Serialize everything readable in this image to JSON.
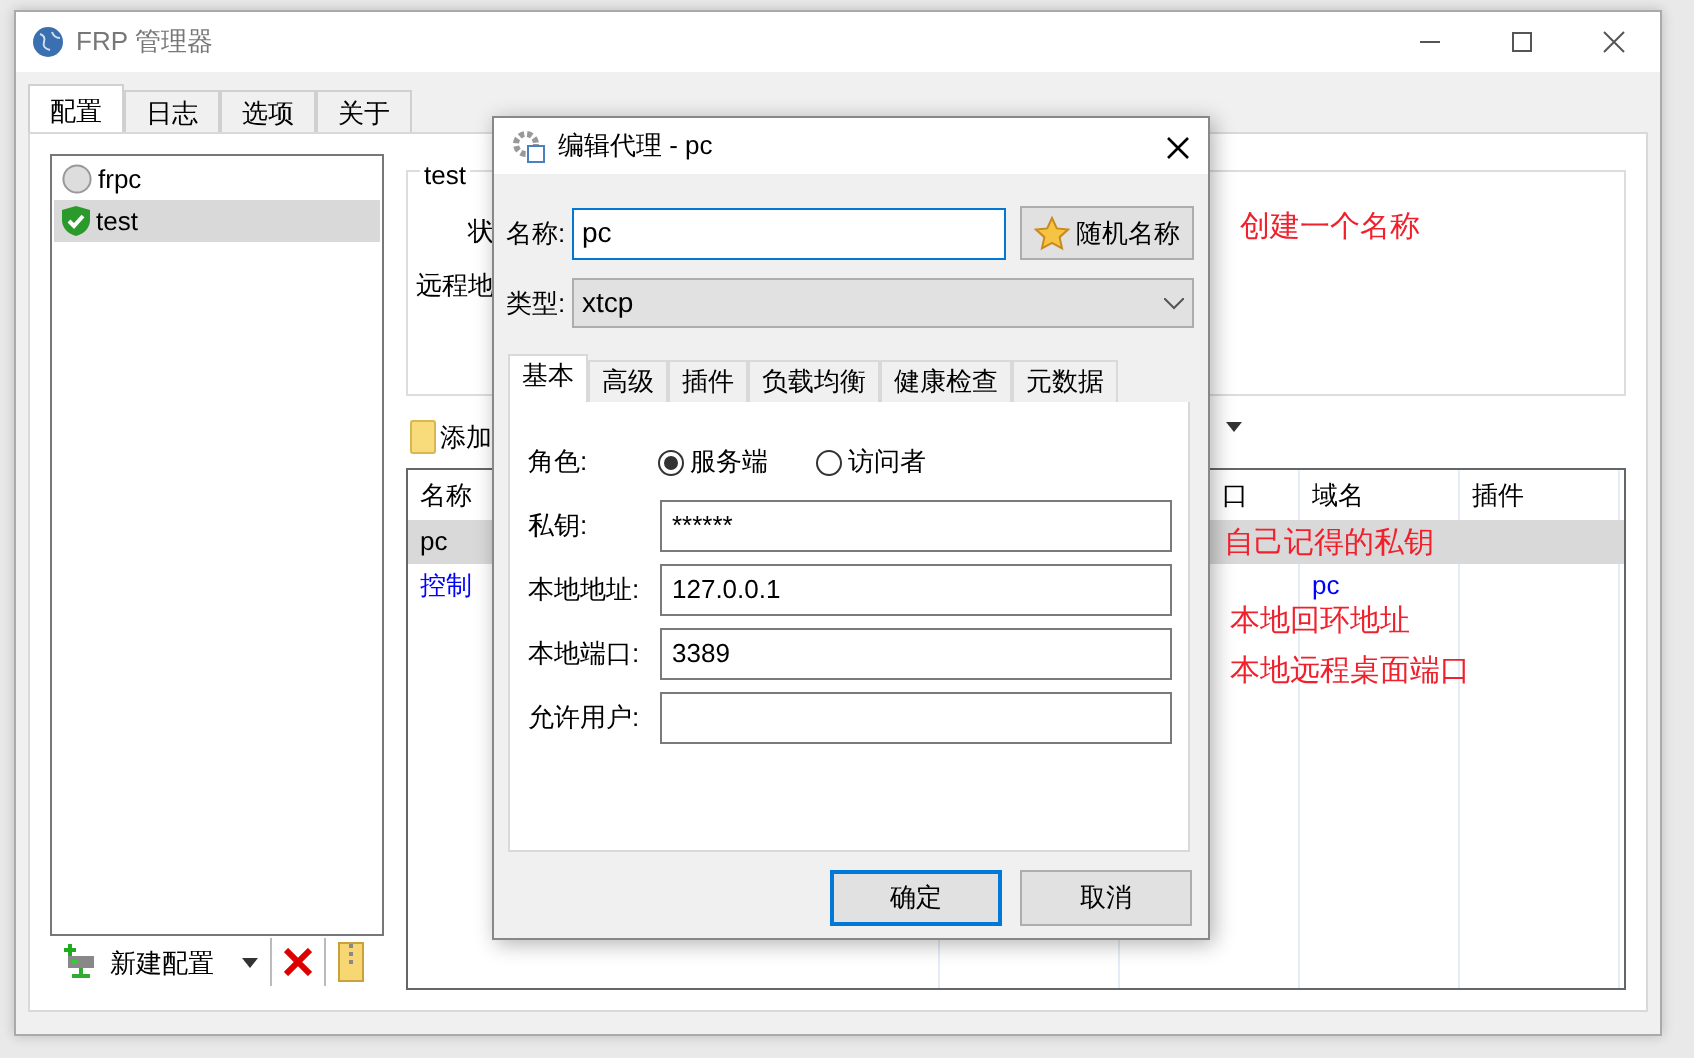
{
  "window": {
    "title": "FRP 管理器"
  },
  "tabs": [
    {
      "label": "配置",
      "selected": true
    },
    {
      "label": "日志",
      "selected": false
    },
    {
      "label": "选项",
      "selected": false
    },
    {
      "label": "关于",
      "selected": false
    }
  ],
  "config_list": [
    {
      "name": "frpc",
      "running": false,
      "selected": false
    },
    {
      "name": "test",
      "running": true,
      "selected": true
    }
  ],
  "list_toolbar": {
    "new_button": "新建配置"
  },
  "detail": {
    "group_title": "test",
    "labels": [
      "状",
      "远程地"
    ]
  },
  "proxy_toolbar": {
    "add_button": "添加"
  },
  "proxy_table": {
    "columns": [
      "名称",
      "口",
      "域名",
      "插件"
    ],
    "rows": [
      {
        "kind": "item",
        "name": "pc",
        "selected": true
      },
      {
        "kind": "link",
        "name": "控制",
        "domain": "pc",
        "selected": false
      }
    ]
  },
  "dialog": {
    "title": "编辑代理 - pc",
    "name_label": "名称:",
    "name_value": "pc",
    "random_button": "随机名称",
    "type_label": "类型:",
    "type_value": "xtcp",
    "tabs": [
      {
        "label": "基本",
        "selected": true
      },
      {
        "label": "高级",
        "selected": false
      },
      {
        "label": "插件",
        "selected": false
      },
      {
        "label": "负载均衡",
        "selected": false
      },
      {
        "label": "健康检查",
        "selected": false
      },
      {
        "label": "元数据",
        "selected": false
      }
    ],
    "role": {
      "label": "角色:",
      "options": [
        {
          "label": "服务端",
          "selected": true
        },
        {
          "label": "访问者",
          "selected": false
        }
      ]
    },
    "fields": [
      {
        "label": "私钥:",
        "value": "******"
      },
      {
        "label": "本地地址:",
        "value": "127.0.0.1"
      },
      {
        "label": "本地端口:",
        "value": "3389"
      },
      {
        "label": "允许用户:"
      }
    ],
    "buttons": [
      {
        "label": "确定",
        "default": true
      },
      {
        "label": "取消",
        "default": false
      }
    ]
  },
  "annotations": [
    "创建一个名称",
    "自己记得的私钥",
    "本地回环地址",
    "本地远程桌面端口"
  ]
}
